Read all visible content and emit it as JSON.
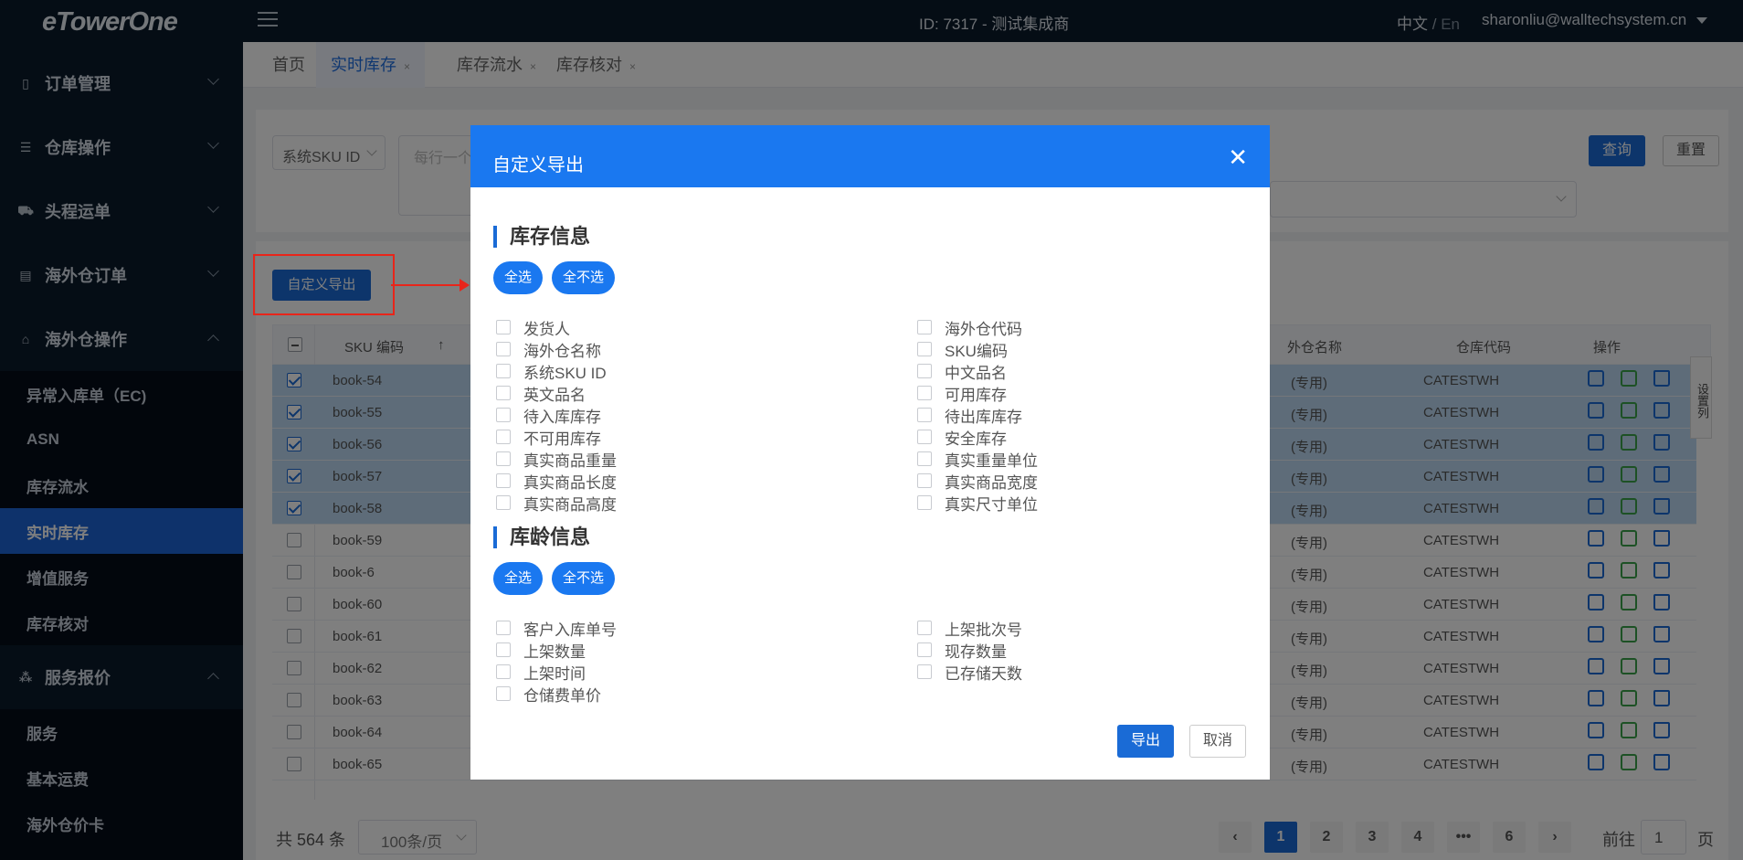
{
  "app": {
    "logo": "eTowerOne"
  },
  "header": {
    "id_label": "ID: 7317 - 测试集成商",
    "lang_zh": "中文",
    "lang_sep": "/",
    "lang_en": "En",
    "user_email": "sharonliu@walltechsystem.cn"
  },
  "sidebar": {
    "groups": [
      {
        "label": "订单管理",
        "icon": "receipt-icon"
      },
      {
        "label": "仓库操作",
        "icon": "list-icon"
      },
      {
        "label": "头程运单",
        "icon": "truck-icon"
      },
      {
        "label": "海外仓订单",
        "icon": "doc-icon"
      },
      {
        "label": "海外仓操作",
        "icon": "warehouse-icon"
      }
    ],
    "ops_items": [
      {
        "label": "异常入库单（EC)"
      },
      {
        "label": "ASN"
      },
      {
        "label": "库存流水"
      },
      {
        "label": "实时库存"
      },
      {
        "label": "增值服务"
      },
      {
        "label": "库存核对"
      }
    ],
    "pricing_group": {
      "label": "服务报价",
      "icon": "network-icon"
    },
    "pricing_items": [
      {
        "label": "服务"
      },
      {
        "label": "基本运费"
      },
      {
        "label": "海外仓价卡"
      }
    ]
  },
  "tabs": [
    {
      "label": "首页",
      "close": ""
    },
    {
      "label": "实时库存",
      "close": "×"
    },
    {
      "label": "库存流水",
      "close": "×"
    },
    {
      "label": "库存核对",
      "close": "×"
    }
  ],
  "filters": {
    "sku_type": "系统SKU ID",
    "textarea_placeholder": "每行一个",
    "query_label": "查询",
    "reset_label": "重置"
  },
  "table": {
    "export_label": "自定义导出",
    "headers": {
      "sku": "SKU 编码",
      "sort": "↑",
      "wh_name": "外仓名称",
      "wh_code": "仓库代码",
      "ops": "操作"
    },
    "settings_label": "设置列",
    "rows": [
      {
        "sku": "book-54",
        "wh": "(专用)",
        "code": "CATESTWH",
        "checked": true
      },
      {
        "sku": "book-55",
        "wh": "(专用)",
        "code": "CATESTWH",
        "checked": true
      },
      {
        "sku": "book-56",
        "wh": "(专用)",
        "code": "CATESTWH",
        "checked": true
      },
      {
        "sku": "book-57",
        "wh": "(专用)",
        "code": "CATESTWH",
        "checked": true
      },
      {
        "sku": "book-58",
        "wh": "(专用)",
        "code": "CATESTWH",
        "checked": true
      },
      {
        "sku": "book-59",
        "wh": "(专用)",
        "code": "CATESTWH",
        "checked": false
      },
      {
        "sku": "book-6",
        "wh": "(专用)",
        "code": "CATESTWH",
        "checked": false
      },
      {
        "sku": "book-60",
        "wh": "(专用)",
        "code": "CATESTWH",
        "checked": false
      },
      {
        "sku": "book-61",
        "wh": "(专用)",
        "code": "CATESTWH",
        "checked": false
      },
      {
        "sku": "book-62",
        "wh": "(专用)",
        "code": "CATESTWH",
        "checked": false
      },
      {
        "sku": "book-63",
        "wh": "(专用)",
        "code": "CATESTWH",
        "checked": false
      },
      {
        "sku": "book-64",
        "wh": "(专用)",
        "code": "CATESTWH",
        "checked": false
      },
      {
        "sku": "book-65",
        "wh": "(专用)",
        "code": "CATESTWH",
        "checked": false
      }
    ]
  },
  "pagination": {
    "total": "共 564 条",
    "per_page": "100条/页",
    "pages": [
      "1",
      "2",
      "3",
      "4",
      "•••",
      "6"
    ],
    "current": "1",
    "prev": "‹",
    "next": "›",
    "goto_label": "前往",
    "goto_value": "1",
    "page_word": "页"
  },
  "modal": {
    "title": "自定义导出",
    "close": "✕",
    "section1": {
      "title": "库存信息",
      "select_all": "全选",
      "select_none": "全不选",
      "left": [
        "发货人",
        "海外仓名称",
        "系统SKU ID",
        "英文品名",
        "待入库库存",
        "不可用库存",
        "真实商品重量",
        "真实商品长度",
        "真实商品高度"
      ],
      "right": [
        "海外仓代码",
        "SKU编码",
        "中文品名",
        "可用库存",
        "待出库库存",
        "安全库存",
        "真实重量单位",
        "真实商品宽度",
        "真实尺寸单位"
      ]
    },
    "section2": {
      "title": "库龄信息",
      "select_all": "全选",
      "select_none": "全不选",
      "left": [
        "客户入库单号",
        "上架数量",
        "上架时间",
        "仓储费单价"
      ],
      "right": [
        "上架批次号",
        "现存数量",
        "已存储天数"
      ]
    },
    "export_label": "导出",
    "cancel_label": "取消"
  },
  "colors": {
    "primary": "#1a78f0",
    "sidebar_bg": "#0a1a2b",
    "annotation": "#e8251a",
    "selected_row": "#bcd9f2"
  }
}
